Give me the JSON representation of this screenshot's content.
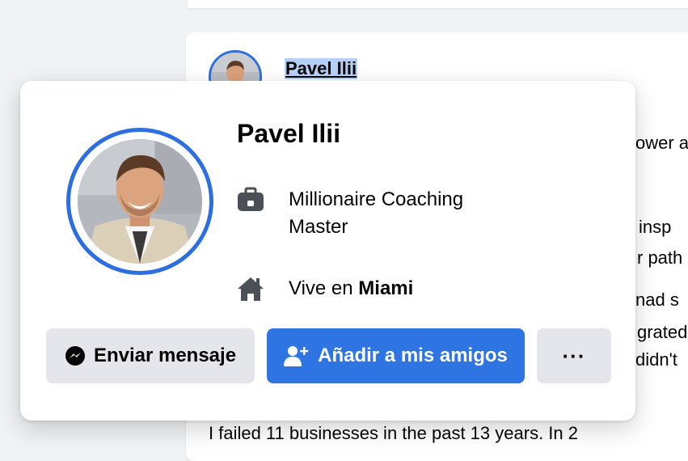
{
  "post": {
    "author": "Pavel Ilii",
    "text_lines": [
      "ower a",
      "insp",
      "r path",
      "nad s",
      "grated",
      "didn't",
      "I failed 11 businesses in the past 13 years. In 2"
    ]
  },
  "hovercard": {
    "name": "Pavel Ilii",
    "work": {
      "icon": "briefcase-icon",
      "text": "Millionaire Coaching Master"
    },
    "home": {
      "icon": "house-icon",
      "prefix": "Vive en ",
      "city": "Miami"
    },
    "buttons": {
      "message": {
        "label": "Enviar mensaje",
        "icon": "messenger-icon"
      },
      "add_friend": {
        "label": "Añadir a mis amigos",
        "icon": "add-friend-icon"
      },
      "more": {
        "label": "···",
        "icon": "more-dots-icon"
      }
    }
  },
  "colors": {
    "accent": "#2f74e3",
    "avatar_ring": "#2d6fe0",
    "secondary_button": "#e4e6eb",
    "page_background": "#f0f2f5"
  }
}
